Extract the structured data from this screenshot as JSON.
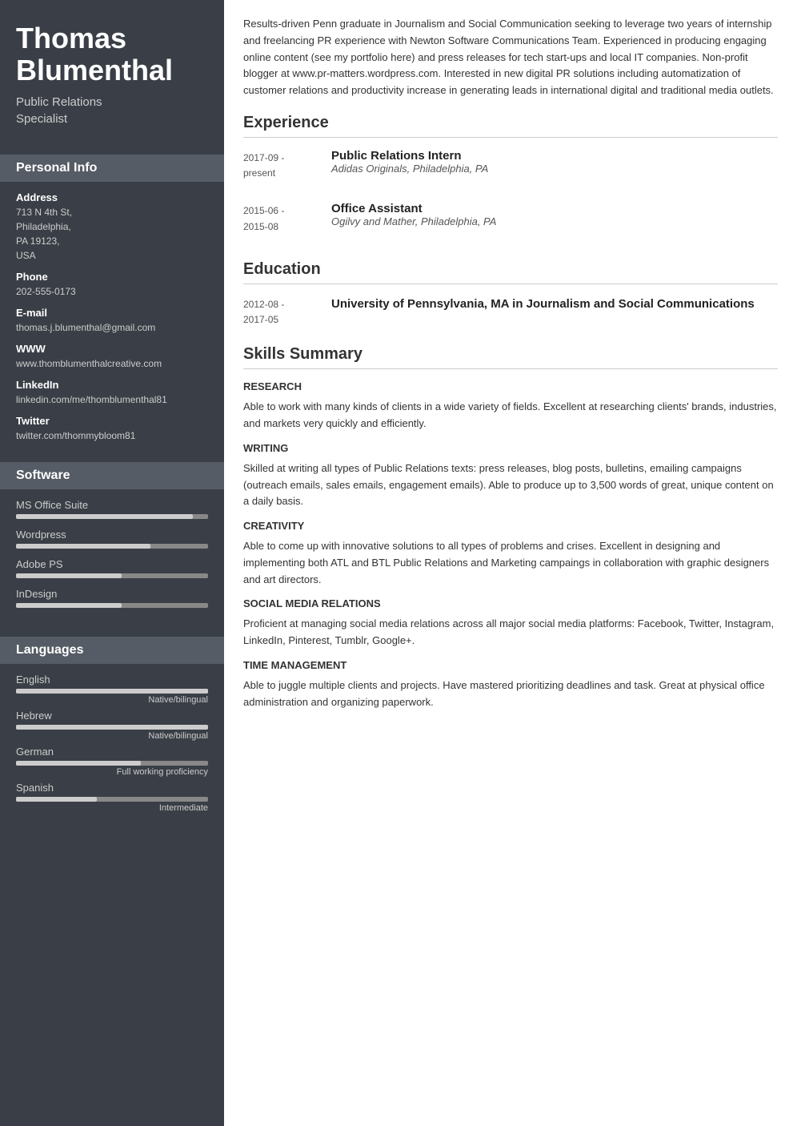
{
  "sidebar": {
    "name": "Thomas Blumenthal",
    "job_title": "Public Relations\nSpecialist",
    "personal_info_label": "Personal Info",
    "address_label": "Address",
    "address": "713 N 4th St,\nPhiladelphia,\nPA 19123,\nUSA",
    "phone_label": "Phone",
    "phone": "202-555-0173",
    "email_label": "E-mail",
    "email": "thomas.j.blumenthal@gmail.com",
    "www_label": "WWW",
    "www": "www.thomblumenthalcreative.com",
    "linkedin_label": "LinkedIn",
    "linkedin": "linkedin.com/me/thomblumenthal81",
    "twitter_label": "Twitter",
    "twitter": "twitter.com/thommybloom81",
    "software_label": "Software",
    "software": [
      {
        "name": "MS Office Suite",
        "pct": 92
      },
      {
        "name": "Wordpress",
        "pct": 70
      },
      {
        "name": "Adobe PS",
        "pct": 55
      },
      {
        "name": "InDesign",
        "pct": 55
      }
    ],
    "languages_label": "Languages",
    "languages": [
      {
        "name": "English",
        "pct": 100,
        "level": "Native/bilingual"
      },
      {
        "name": "Hebrew",
        "pct": 100,
        "level": "Native/bilingual"
      },
      {
        "name": "German",
        "pct": 65,
        "level": "Full working proficiency"
      },
      {
        "name": "Spanish",
        "pct": 42,
        "level": "Intermediate"
      }
    ]
  },
  "main": {
    "summary": "Results-driven Penn graduate in Journalism and Social Communication seeking to leverage two years of internship and freelancing PR experience with Newton Software Communications Team. Experienced in producing engaging online content (see my portfolio here) and press releases for tech start-ups and local IT companies. Non-profit blogger at www.pr-matters.wordpress.com. Interested in new digital PR solutions including automatization of customer relations and productivity increase in generating leads in international digital and traditional media outlets.",
    "experience_label": "Experience",
    "experience": [
      {
        "date": "2017-09 -\npresent",
        "role": "Public Relations Intern",
        "company": "Adidas Originals, Philadelphia, PA"
      },
      {
        "date": "2015-06 -\n2015-08",
        "role": "Office Assistant",
        "company": "Ogilvy and Mather, Philadelphia, PA"
      }
    ],
    "education_label": "Education",
    "education": [
      {
        "date": "2012-08 -\n2017-05",
        "degree": "University of Pennsylvania, MA in Journalism and Social Communications"
      }
    ],
    "skills_label": "Skills Summary",
    "skills": [
      {
        "title": "RESEARCH",
        "desc": "Able to work with many kinds of clients in a wide variety of fields. Excellent at researching clients' brands, industries, and markets very quickly and efficiently."
      },
      {
        "title": "WRITING",
        "desc": "Skilled at writing all types of Public Relations texts: press releases, blog posts, bulletins, emailing campaigns (outreach emails, sales emails, engagement emails). Able to produce up to 3,500 words of great, unique content on a daily basis."
      },
      {
        "title": "CREATIVITY",
        "desc": "Able to come up with innovative solutions to all types of problems and crises. Excellent in designing and implementing both ATL and BTL Public Relations and Marketing campaings in collaboration with graphic designers and art directors."
      },
      {
        "title": "SOCIAL MEDIA RELATIONS",
        "desc": "Proficient at managing social media relations across all major social media platforms: Facebook, Twitter, Instagram, LinkedIn, Pinterest, Tumblr, Google+."
      },
      {
        "title": "TIME MANAGEMENT",
        "desc": "Able to juggle multiple clients and projects. Have mastered prioritizing deadlines and task. Great at physical office administration and organizing paperwork."
      }
    ]
  }
}
